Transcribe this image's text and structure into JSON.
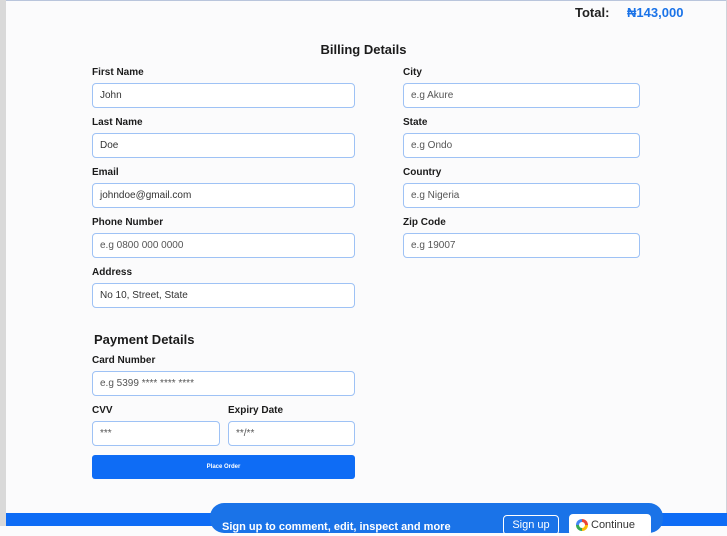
{
  "header": {
    "total_label": "Total:",
    "total_value": "₦143,000"
  },
  "billing": {
    "title": "Billing Details",
    "first_name": {
      "label": "First Name",
      "value": "John"
    },
    "last_name": {
      "label": "Last Name",
      "value": "Doe"
    },
    "email": {
      "label": "Email",
      "value": "johndoe@gmail.com"
    },
    "phone": {
      "label": "Phone Number",
      "placeholder": "e.g 0800 000 0000"
    },
    "address": {
      "label": "Address",
      "value": "No 10, Street, State"
    },
    "city": {
      "label": "City",
      "placeholder": "e.g Akure"
    },
    "state": {
      "label": "State",
      "placeholder": "e.g Ondo"
    },
    "country": {
      "label": "Country",
      "placeholder": "e.g Nigeria"
    },
    "zip": {
      "label": "Zip Code",
      "placeholder": "e.g 19007"
    }
  },
  "payment": {
    "title": "Payment Details",
    "card_number": {
      "label": "Card Number",
      "placeholder": "e.g 5399 **** **** ****"
    },
    "cvv": {
      "label": "CVV",
      "placeholder": "***"
    },
    "expiry": {
      "label": "Expiry Date",
      "placeholder": "**/**"
    },
    "place_order": "Place Order"
  },
  "signup_banner": {
    "text": "Sign up to comment, edit, inspect and more",
    "signup_label": "Sign up",
    "continue_label": "Continue"
  },
  "colors": {
    "accent": "#1a73e8",
    "button": "#0e6cf5",
    "input_border": "#9ec2f5"
  }
}
